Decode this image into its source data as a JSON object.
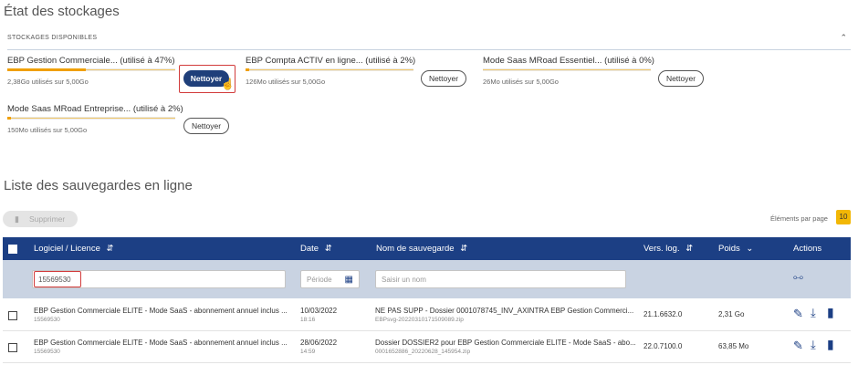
{
  "page_title": "État des stockages",
  "storage": {
    "section_label": "STOCKAGES DISPONIBLES",
    "items": [
      {
        "name": "EBP Gestion Commerciale... (utilisé à 47%)",
        "usage": "2,38Go utilisés sur 5,00Go",
        "percent": 47,
        "button": "Nettoyer"
      },
      {
        "name": "EBP Compta ACTIV en ligne... (utilisé à 2%)",
        "usage": "126Mo utilisés sur 5,00Go",
        "percent": 2,
        "button": "Nettoyer"
      },
      {
        "name": "Mode Saas MRoad Essentiel... (utilisé à 0%)",
        "usage": "26Mo utilisés sur 5,00Go",
        "percent": 0,
        "button": "Nettoyer"
      },
      {
        "name": "Mode Saas MRoad Entreprise... (utilisé à 2%)",
        "usage": "150Mo utilisés sur 5,00Go",
        "percent": 2,
        "button": "Nettoyer"
      }
    ]
  },
  "list_title": "Liste des sauvegardes en ligne",
  "delete_label": "Supprimer",
  "pager": {
    "label": "Éléments par page",
    "value": "10"
  },
  "table": {
    "headers": {
      "software": "Logiciel / Licence",
      "date": "Date",
      "backup_name": "Nom de sauvegarde",
      "version": "Vers. log.",
      "weight": "Poids",
      "actions": "Actions"
    },
    "filters": {
      "license_value": "15569530",
      "period_placeholder": "Période",
      "name_placeholder": "Saisir un nom"
    },
    "rows": [
      {
        "software": "EBP Gestion Commerciale ELITE - Mode SaaS - abonnement annuel inclus ...",
        "license": "15569530",
        "date": "10/03/2022",
        "time": "18:16",
        "backup_name": "NE PAS SUPP - Dossier 0001078745_INV_AXINTRA EBP Gestion Commerci...",
        "backup_file": "EBPsvg-20220310171509089.zip",
        "version": "21.1.6632.0",
        "weight": "2,31 Go"
      },
      {
        "software": "EBP Gestion Commerciale ELITE - Mode SaaS - abonnement annuel inclus ...",
        "license": "15569530",
        "date": "28/06/2022",
        "time": "14:59",
        "backup_name": "Dossier DOSSIER2 pour EBP Gestion Commerciale ELITE - Mode SaaS - abo...",
        "backup_file": "0001652886_20220628_145954.zip",
        "version": "22.0.7100.0",
        "weight": "63,85 Mo"
      }
    ]
  },
  "colors": {
    "header_bg": "#1c3f84",
    "accent": "#f0a000",
    "highlight": "#d23b3b"
  }
}
